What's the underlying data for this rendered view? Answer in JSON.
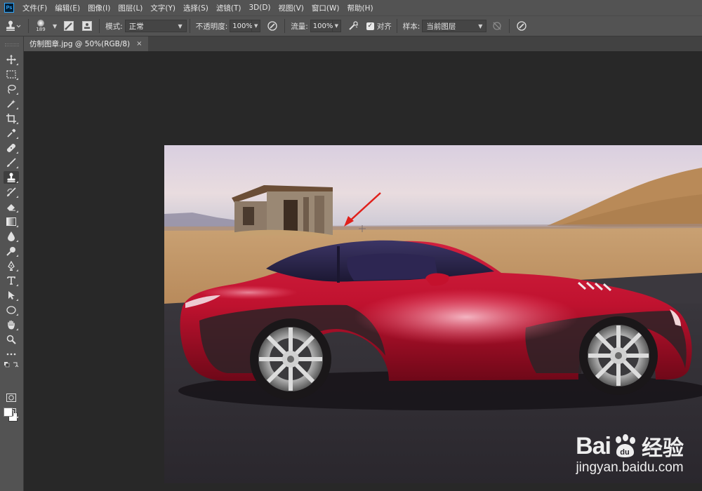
{
  "app": {
    "logo": "Ps"
  },
  "menu": [
    "文件(F)",
    "编辑(E)",
    "图像(I)",
    "图层(L)",
    "文字(Y)",
    "选择(S)",
    "滤镜(T)",
    "3D(D)",
    "视图(V)",
    "窗口(W)",
    "帮助(H)"
  ],
  "options": {
    "brush_size": "189",
    "mode_label": "模式:",
    "mode_value": "正常",
    "opacity_label": "不透明度:",
    "opacity_value": "100%",
    "flow_label": "流量:",
    "flow_value": "100%",
    "align_label": "对齐",
    "align_checked": true,
    "sample_label": "样本:",
    "sample_value": "当前图层"
  },
  "document": {
    "tab_title": "仿制图章.jpg @ 50%(RGB/8)",
    "close_glyph": "×"
  },
  "tools": [
    "move-tool",
    "marquee-tool",
    "lasso-tool",
    "magic-wand-tool",
    "crop-tool",
    "eyedropper-tool",
    "healing-brush-tool",
    "brush-tool",
    "clone-stamp-tool",
    "history-brush-tool",
    "eraser-tool",
    "gradient-tool",
    "blur-tool",
    "dodge-tool",
    "pen-tool",
    "type-tool",
    "path-selection-tool",
    "ellipse-tool",
    "hand-tool",
    "zoom-tool",
    "more-tools",
    "quick-mask",
    "screen-mode"
  ],
  "active_tool": "clone-stamp-tool",
  "colors": {
    "foreground": "#ffffff",
    "background": "#ffffff",
    "car": "#b5122e",
    "annotation_arrow": "#e0201b"
  },
  "watermark": {
    "logo_bai": "Bai",
    "logo_cn": "经验",
    "url": "jingyan.baidu.com"
  }
}
